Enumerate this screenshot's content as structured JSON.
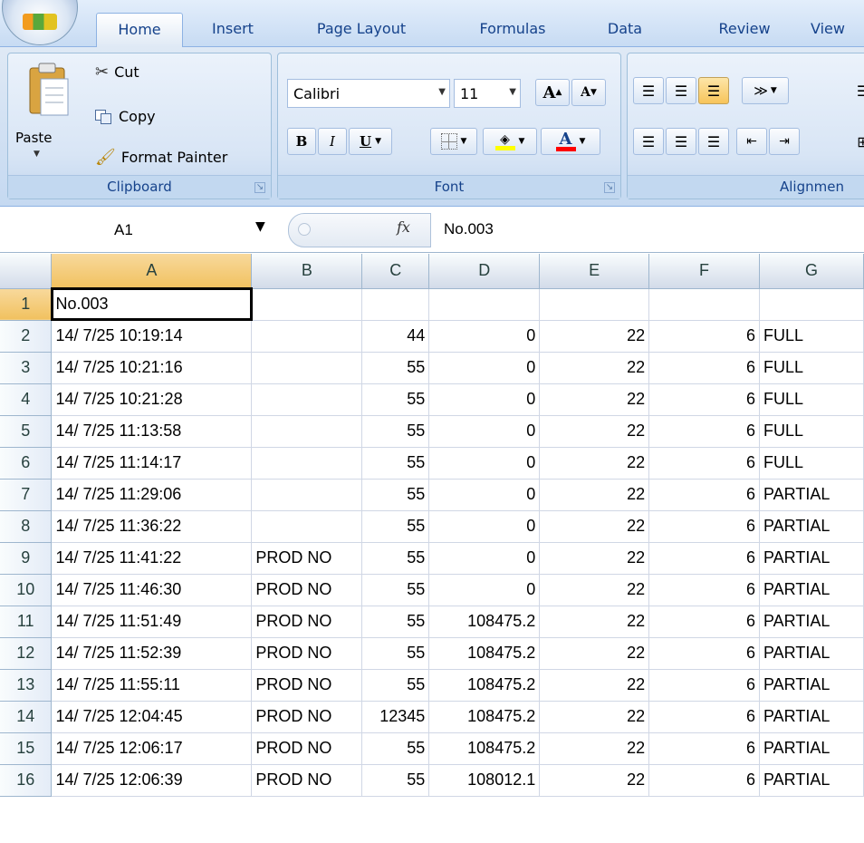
{
  "tabs": [
    {
      "label": "Home",
      "active": true
    },
    {
      "label": "Insert",
      "active": false
    },
    {
      "label": "Page Layout",
      "active": false
    },
    {
      "label": "Formulas",
      "active": false
    },
    {
      "label": "Data",
      "active": false
    },
    {
      "label": "Review",
      "active": false
    },
    {
      "label": "View",
      "active": false
    }
  ],
  "clipboard": {
    "paste_label": "Paste",
    "cut_label": "Cut",
    "copy_label": "Copy",
    "format_painter_label": "Format Painter",
    "group_label": "Clipboard"
  },
  "font": {
    "family_value": "Calibri",
    "size_value": "11",
    "bold_label": "B",
    "italic_label": "I",
    "underline_label": "U",
    "grow_label": "A",
    "shrink_label": "A",
    "font_color_label": "A",
    "group_label": "Font",
    "fill_color": "#ffff00",
    "text_color": "#ff0000"
  },
  "alignment": {
    "group_label": "Alignmen"
  },
  "formula_bar": {
    "name_box": "A1",
    "fx_label": "fx",
    "content": "No.003"
  },
  "sheet": {
    "columns": [
      "A",
      "B",
      "C",
      "D",
      "E",
      "F",
      "G"
    ],
    "selected_column": "A",
    "selected_row": "1",
    "rows": [
      {
        "n": "1",
        "cells": [
          "No.003",
          "",
          "",
          "",
          "",
          "",
          ""
        ]
      },
      {
        "n": "2",
        "cells": [
          "14/ 7/25 10:19:14",
          "",
          "44",
          "0",
          "22",
          "6",
          "FULL"
        ]
      },
      {
        "n": "3",
        "cells": [
          "14/ 7/25 10:21:16",
          "",
          "55",
          "0",
          "22",
          "6",
          "FULL"
        ]
      },
      {
        "n": "4",
        "cells": [
          "14/ 7/25 10:21:28",
          "",
          "55",
          "0",
          "22",
          "6",
          "FULL"
        ]
      },
      {
        "n": "5",
        "cells": [
          "14/ 7/25 11:13:58",
          "",
          "55",
          "0",
          "22",
          "6",
          "FULL"
        ]
      },
      {
        "n": "6",
        "cells": [
          "14/ 7/25 11:14:17",
          "",
          "55",
          "0",
          "22",
          "6",
          "FULL"
        ]
      },
      {
        "n": "7",
        "cells": [
          "14/ 7/25 11:29:06",
          "",
          "55",
          "0",
          "22",
          "6",
          "PARTIAL"
        ]
      },
      {
        "n": "8",
        "cells": [
          "14/ 7/25 11:36:22",
          "",
          "55",
          "0",
          "22",
          "6",
          "PARTIAL"
        ]
      },
      {
        "n": "9",
        "cells": [
          "14/ 7/25 11:41:22",
          "PROD NO",
          "55",
          "0",
          "22",
          "6",
          "PARTIAL"
        ]
      },
      {
        "n": "10",
        "cells": [
          "14/ 7/25 11:46:30",
          "PROD NO",
          "55",
          "0",
          "22",
          "6",
          "PARTIAL"
        ]
      },
      {
        "n": "11",
        "cells": [
          "14/ 7/25 11:51:49",
          "PROD NO",
          "55",
          "108475.2",
          "22",
          "6",
          "PARTIAL"
        ]
      },
      {
        "n": "12",
        "cells": [
          "14/ 7/25 11:52:39",
          "PROD NO",
          "55",
          "108475.2",
          "22",
          "6",
          "PARTIAL"
        ]
      },
      {
        "n": "13",
        "cells": [
          "14/ 7/25 11:55:11",
          "PROD NO",
          "55",
          "108475.2",
          "22",
          "6",
          "PARTIAL"
        ]
      },
      {
        "n": "14",
        "cells": [
          "14/ 7/25 12:04:45",
          "PROD NO",
          "12345",
          "108475.2",
          "22",
          "6",
          "PARTIAL"
        ]
      },
      {
        "n": "15",
        "cells": [
          "14/ 7/25 12:06:17",
          "PROD NO",
          "55",
          "108475.2",
          "22",
          "6",
          "PARTIAL"
        ]
      },
      {
        "n": "16",
        "cells": [
          "14/ 7/25 12:06:39",
          "PROD NO",
          "55",
          "108012.1",
          "22",
          "6",
          "PARTIAL"
        ]
      }
    ]
  }
}
